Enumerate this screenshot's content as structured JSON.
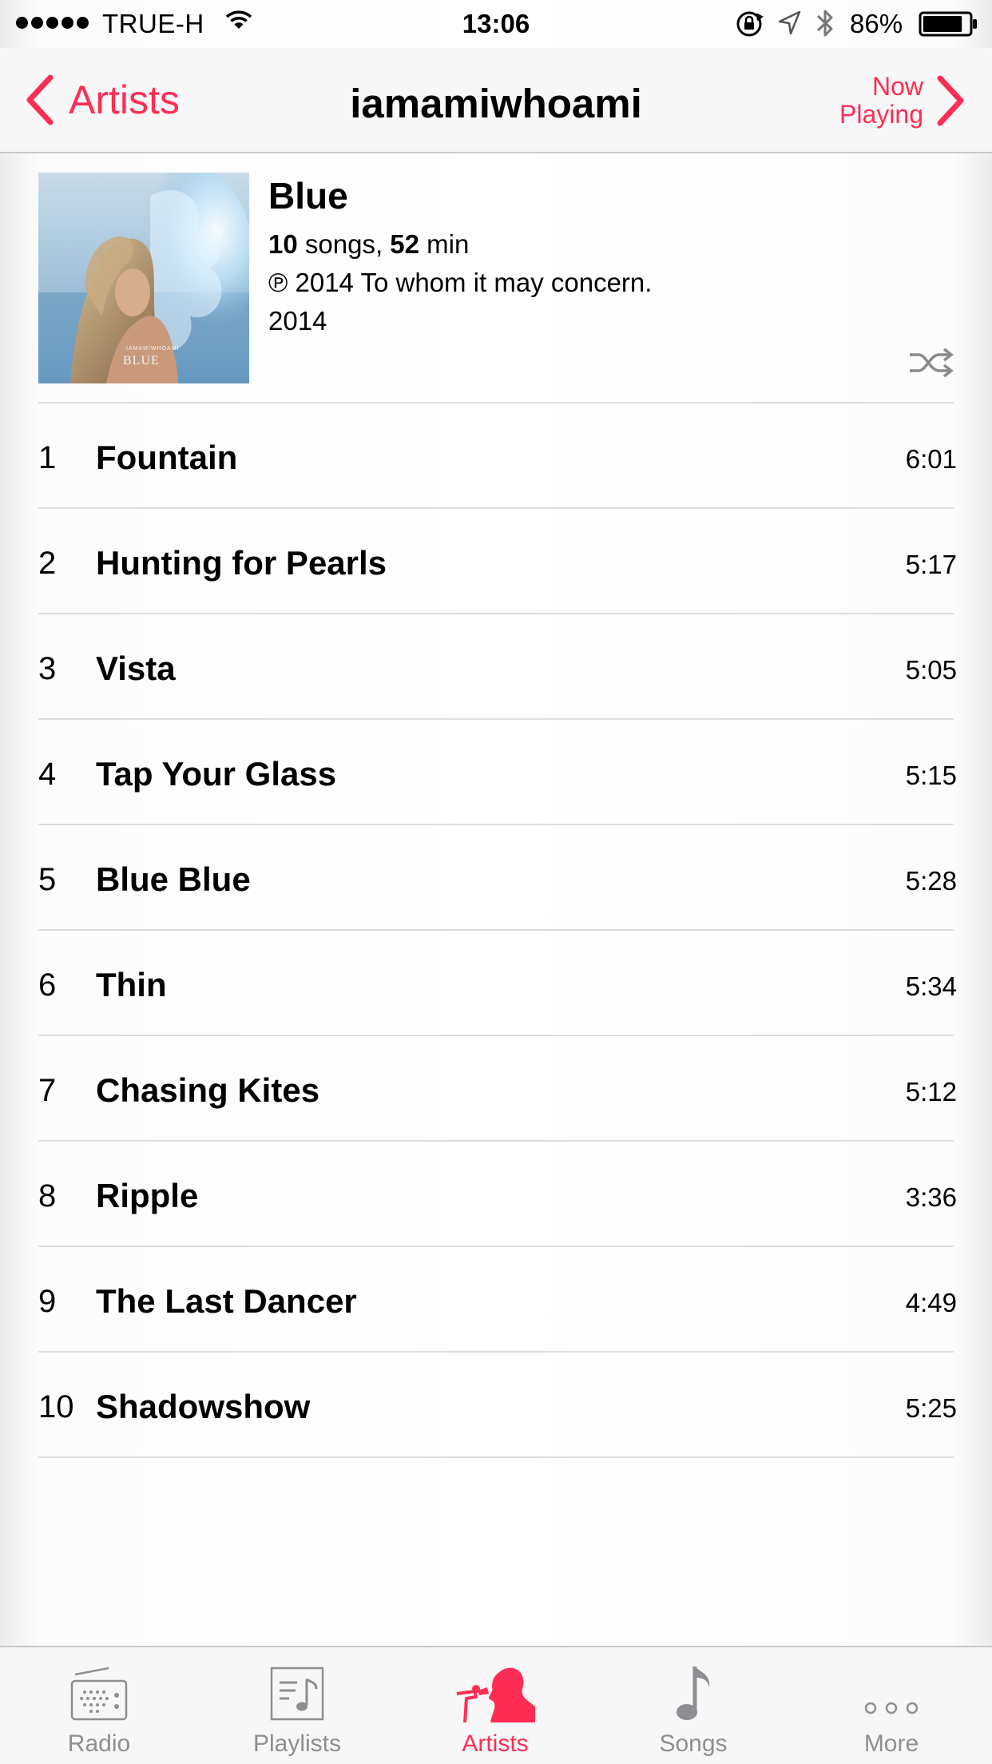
{
  "status_bar": {
    "carrier": "TRUE-H",
    "time": "13:06",
    "battery_percent": "86%",
    "battery_level": 0.86
  },
  "nav": {
    "back_label": "Artists",
    "title": "iamamiwhoami",
    "now_playing_line1": "Now",
    "now_playing_line2": "Playing"
  },
  "album": {
    "title": "Blue",
    "song_count": "10",
    "songs_word": " songs, ",
    "duration": "52",
    "duration_unit": " min",
    "copyright": "℗ 2014 To whom it may concern.",
    "year": "2014",
    "art_text_top": "IAMAMIWHOAMI",
    "art_text_title": "BLUE"
  },
  "tracks": [
    {
      "num": "1",
      "title": "Fountain",
      "duration": "6:01"
    },
    {
      "num": "2",
      "title": "Hunting for Pearls",
      "duration": "5:17"
    },
    {
      "num": "3",
      "title": "Vista",
      "duration": "5:05"
    },
    {
      "num": "4",
      "title": "Tap Your Glass",
      "duration": "5:15"
    },
    {
      "num": "5",
      "title": "Blue Blue",
      "duration": "5:28"
    },
    {
      "num": "6",
      "title": "Thin",
      "duration": "5:34"
    },
    {
      "num": "7",
      "title": "Chasing Kites",
      "duration": "5:12"
    },
    {
      "num": "8",
      "title": "Ripple",
      "duration": "3:36"
    },
    {
      "num": "9",
      "title": "The Last Dancer",
      "duration": "4:49"
    },
    {
      "num": "10",
      "title": "Shadowshow",
      "duration": "5:25"
    }
  ],
  "tabs": [
    {
      "label": "Radio",
      "icon": "radio-icon"
    },
    {
      "label": "Playlists",
      "icon": "playlists-icon"
    },
    {
      "label": "Artists",
      "icon": "artists-icon",
      "active": true
    },
    {
      "label": "Songs",
      "icon": "songs-icon"
    },
    {
      "label": "More",
      "icon": "more-icon"
    }
  ],
  "colors": {
    "accent": "#ff2d55",
    "inactive_tab": "#8e8e93",
    "divider": "#dddddd"
  }
}
